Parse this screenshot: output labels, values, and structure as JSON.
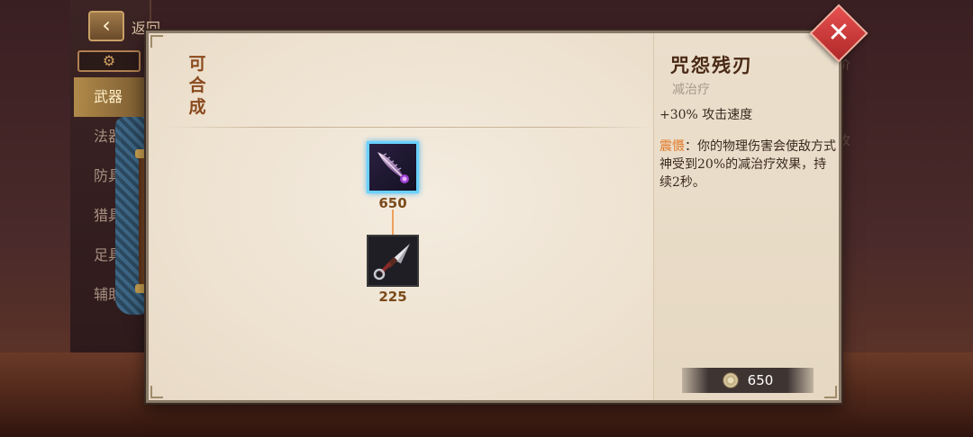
{
  "background": {
    "back_label": "返回",
    "categories": [
      {
        "label": "武器",
        "active": true
      },
      {
        "label": "法器",
        "active": false
      },
      {
        "label": "防具",
        "active": false
      },
      {
        "label": "猎具",
        "active": false
      },
      {
        "label": "足具",
        "active": false
      },
      {
        "label": "辅助",
        "active": false
      }
    ],
    "right_partial_1": "价",
    "right_partial_2": "攻"
  },
  "dialog": {
    "section_title": "可合成",
    "tree": {
      "top_item": {
        "price": "650",
        "icon": "purple-feather-blade-icon"
      },
      "bottom_item": {
        "price": "225",
        "icon": "kunai-dagger-icon"
      }
    },
    "detail": {
      "name": "咒怨残刃",
      "tag": "减治疗",
      "stat": "+30% 攻击速度",
      "passive_name": "震慑",
      "passive_desc": "：你的物理伤害会使敌方式神受到20%的减治疗效果，持续2秒。"
    },
    "total": {
      "price": "650",
      "icon": "coin-icon"
    }
  },
  "colors": {
    "accent_orange": "#e27a2a",
    "close_red": "#d83c3c",
    "selected_border": "#6ad0ff"
  }
}
